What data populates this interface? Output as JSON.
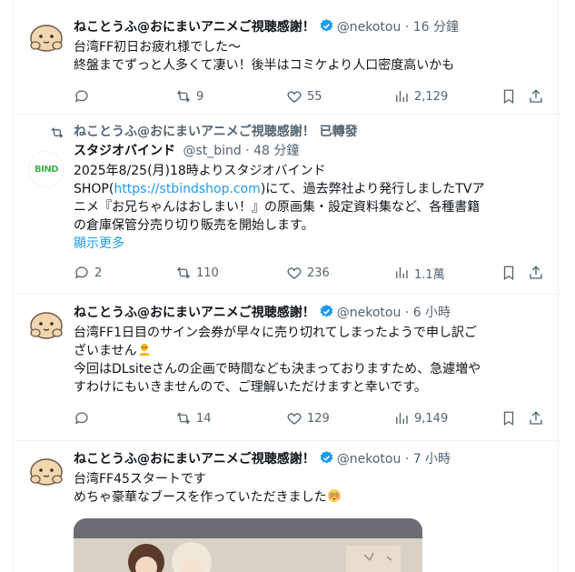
{
  "tweets": [
    {
      "name": "ねことうふ@おにまいアニメご視聴感謝！",
      "handle": "@nekotou",
      "time": "16 分鐘",
      "lines": [
        "台湾FF初日お疲れ様でした～",
        "終盤までずっと人多くて凄い！後半はコミケより人口密度高いかも"
      ],
      "replies": "",
      "reposts": "9",
      "likes": "55",
      "views": "2,129"
    },
    {
      "repost_label": "ねことうふ@おにまいアニメご視聴感謝！ 已轉發",
      "name": "スタジオバインド",
      "handle": "@st_bind",
      "time": "48 分鐘",
      "avatar_text": "BIND",
      "line1": "2025年8/25(月)18時よりスタジオバインド",
      "line2_pre": "SHOP(",
      "line2_link": "https://stbindshop.com",
      "line2_post": ")にて、過去弊社より発行しましたTVア",
      "line3": "ニメ『お兄ちゃんはおしまい！』の原画集・設定資料集など、各種書籍",
      "line4": "の倉庫保管分売り切り販売を開始します。",
      "show_more": "顯示更多",
      "replies": "2",
      "reposts": "110",
      "likes": "236",
      "views": "1.1萬"
    },
    {
      "name": "ねことうふ@おにまいアニメご視聴感謝！",
      "handle": "@nekotou",
      "time": "6 小時",
      "line1": "台湾FF1日目のサイン会券が早々に売り切れてしまったようで申し訳ご",
      "line2": "ざいません",
      "line3": "今回はDLsiteさんの企画で時間なども決まっておりますため、急遽増や",
      "line4": "すわけにもいきませんので、ご理解いただけますと幸いです。",
      "replies": "",
      "reposts": "14",
      "likes": "129",
      "views": "9,149"
    },
    {
      "name": "ねことうふ@おにまいアニメご視聴感謝！",
      "handle": "@nekotou",
      "time": "7 小時",
      "line1": "台湾FF45スタートです",
      "line2": "めちゃ豪華なブースを作っていただきました"
    }
  ],
  "separator": " · ",
  "colors": {
    "accent": "#1d9bf0",
    "text": "#0f1419",
    "muted": "#536471",
    "border": "#eff3f4",
    "bind_green": "#3cb44a"
  }
}
